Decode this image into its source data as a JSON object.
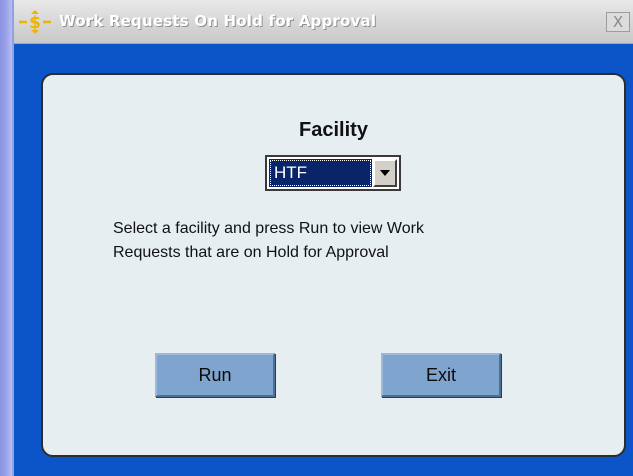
{
  "window": {
    "title": "Work Requests On Hold for Approval",
    "close_glyph": "X",
    "app_icon": "dollar-arrows-icon"
  },
  "form": {
    "facility_label": "Facility",
    "facility_selected": "HTF",
    "instructions_line1": "Select a facility and press Run to view Work",
    "instructions_line2": "Requests that are on Hold for Approval"
  },
  "buttons": {
    "run_label": "Run",
    "exit_label": "Exit"
  },
  "colors": {
    "window_bg": "#0b55c9",
    "panel_bg": "#e6eef2",
    "selection_bg": "#0a246a",
    "button_bg": "#7fa5cf"
  }
}
